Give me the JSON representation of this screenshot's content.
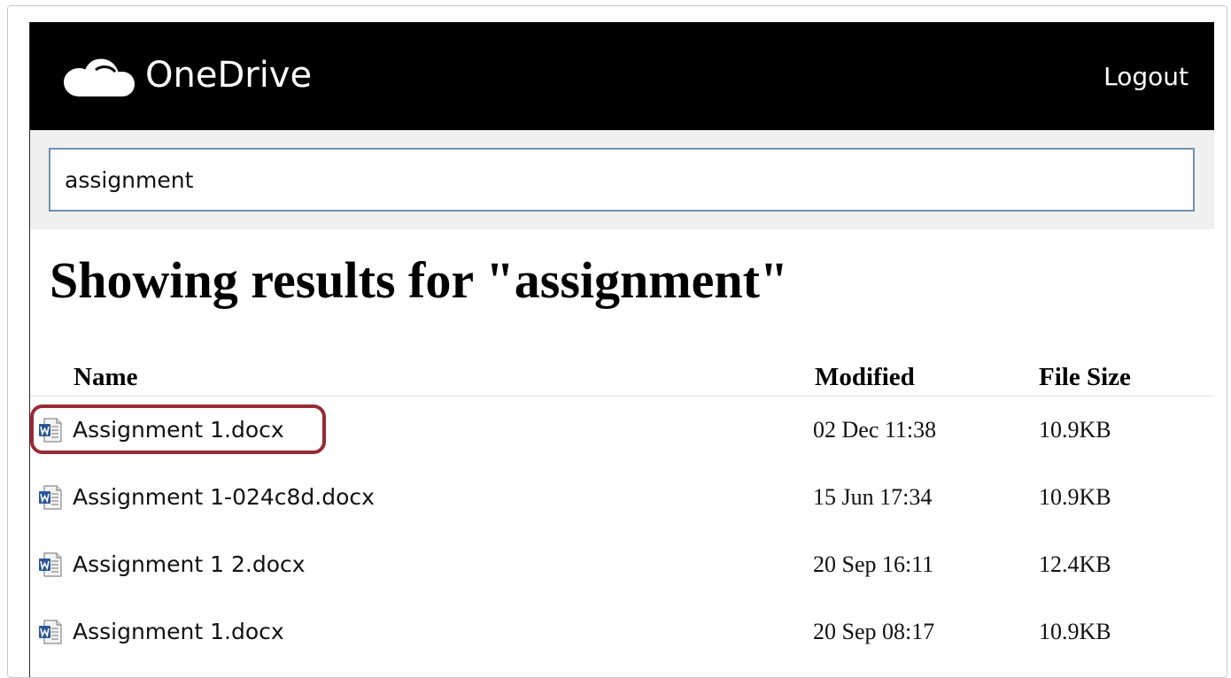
{
  "header": {
    "app_name": "OneDrive",
    "logo_icon": "cloud-icon",
    "logout_label": "Logout"
  },
  "search": {
    "value": "assignment"
  },
  "results": {
    "heading": "Showing results for \"assignment\"",
    "columns": {
      "name": "Name",
      "modified": "Modified",
      "size": "File Size"
    },
    "files": [
      {
        "name": "Assignment 1.docx",
        "modified": "02 Dec 11:38",
        "size": "10.9KB",
        "icon": "word-document-icon",
        "highlighted": true
      },
      {
        "name": "Assignment 1-024c8d.docx",
        "modified": "15 Jun 17:34",
        "size": "10.9KB",
        "icon": "word-document-icon",
        "highlighted": false
      },
      {
        "name": "Assignment 1 2.docx",
        "modified": "20 Sep 16:11",
        "size": "12.4KB",
        "icon": "word-document-icon",
        "highlighted": false
      },
      {
        "name": "Assignment 1.docx",
        "modified": "20 Sep 08:17",
        "size": "10.9KB",
        "icon": "word-document-icon",
        "highlighted": false
      }
    ]
  },
  "colors": {
    "header_background": "#000000",
    "search_area_background": "#f0f0f0",
    "search_border": "#6f8fb0",
    "highlight_ring": "#962a35",
    "word_blue": "#2b5797"
  }
}
